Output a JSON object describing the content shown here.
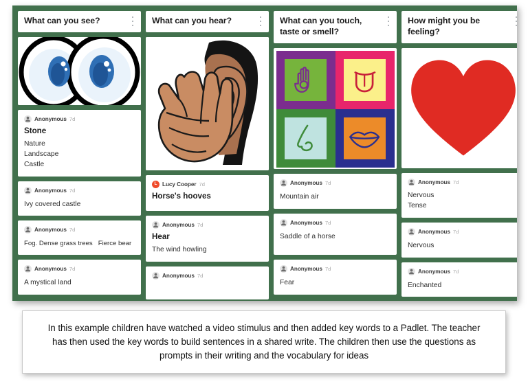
{
  "board": {
    "background_color": "#41704c",
    "columns": [
      {
        "id": "see",
        "header": {
          "title": "What can you see?",
          "menu_icon": "kebab-menu-icon"
        },
        "media": {
          "type": "eyes-illustration",
          "alt": "Cartoon pair of eyes"
        },
        "posts": [
          {
            "author": "Anonymous",
            "avatar": "anonymous-avatar-icon",
            "timestamp": "7d",
            "title": "Stone",
            "lines": [
              "Nature",
              "Landscape",
              "Castle"
            ]
          },
          {
            "author": "Anonymous",
            "avatar": "anonymous-avatar-icon",
            "timestamp": "7d",
            "title": "",
            "lines": [
              "Ivy covered castle"
            ]
          },
          {
            "author": "Anonymous",
            "avatar": "anonymous-avatar-icon",
            "timestamp": "7d",
            "title": "",
            "lines": [
              "Fog. Dense grass trees   Fierce bear"
            ]
          },
          {
            "author": "Anonymous",
            "avatar": "anonymous-avatar-icon",
            "timestamp": "7d",
            "title": "",
            "lines": [
              "A mystical land"
            ]
          }
        ]
      },
      {
        "id": "hear",
        "header": {
          "title": "What can you hear?",
          "menu_icon": "kebab-menu-icon"
        },
        "media": {
          "type": "hand-to-ear-illustration",
          "alt": "Person cupping hand to ear"
        },
        "posts": [
          {
            "author": "Lucy Cooper",
            "avatar": "lucy-cooper-avatar",
            "avatar_initial": "L",
            "avatar_color": "#ef4a2a",
            "timestamp": "7d",
            "title": "Horse's hooves",
            "lines": []
          },
          {
            "author": "Anonymous",
            "avatar": "anonymous-avatar-icon",
            "timestamp": "7d",
            "title": "Hear",
            "lines": [
              "The wind howling"
            ]
          },
          {
            "author": "Anonymous",
            "avatar": "anonymous-avatar-icon",
            "timestamp": "7d",
            "title": "",
            "lines": []
          }
        ]
      },
      {
        "id": "touch-taste-smell",
        "header": {
          "title": "What can you touch, taste or smell?",
          "menu_icon": "kebab-menu-icon"
        },
        "media": {
          "type": "five-senses-grid",
          "alt": "Four squares: hand, tongue, nose, lips"
        },
        "posts": [
          {
            "author": "Anonymous",
            "avatar": "anonymous-avatar-icon",
            "timestamp": "7d",
            "title": "",
            "lines": [
              "Mountain air"
            ]
          },
          {
            "author": "Anonymous",
            "avatar": "anonymous-avatar-icon",
            "timestamp": "7d",
            "title": "",
            "lines": [
              "Saddle of a horse"
            ]
          },
          {
            "author": "Anonymous",
            "avatar": "anonymous-avatar-icon",
            "timestamp": "7d",
            "title": "",
            "lines": [
              "Fear"
            ]
          }
        ]
      },
      {
        "id": "feeling",
        "header": {
          "title": "How might you be feeling?",
          "menu_icon": "kebab-menu-icon"
        },
        "media": {
          "type": "heart-illustration",
          "alt": "Red heart",
          "color": "#e02b23"
        },
        "posts": [
          {
            "author": "Anonymous",
            "avatar": "anonymous-avatar-icon",
            "timestamp": "7d",
            "title": "",
            "lines": [
              "Nervous",
              "Tense"
            ]
          },
          {
            "author": "Anonymous",
            "avatar": "anonymous-avatar-icon",
            "timestamp": "7d",
            "title": "",
            "lines": [
              "Nervous"
            ]
          },
          {
            "author": "Anonymous",
            "avatar": "anonymous-avatar-icon",
            "timestamp": "7d",
            "title": "",
            "lines": [
              "Enchanted"
            ]
          }
        ]
      }
    ]
  },
  "caption": {
    "text": "In this example children have watched a video stimulus and then added key words to a Padlet. The teacher has then used the key words to build sentences in a shared write. The children then use the questions as prompts in their writing and the vocabulary for ideas"
  },
  "senses_colors": {
    "hand_border": "#7b2d8e",
    "hand_bg": "#76b43c",
    "hand_stroke": "#7b2d8e",
    "tongue_border": "#e8256b",
    "tongue_bg": "#fbf08a",
    "tongue_stroke": "#c8203a",
    "nose_border": "#3f8b3a",
    "nose_bg": "#bfe3e0",
    "nose_stroke": "#3f8b3a",
    "lips_border": "#2a2f8f",
    "lips_bg": "#ec8b29",
    "lips_stroke": "#2a2f8f"
  }
}
